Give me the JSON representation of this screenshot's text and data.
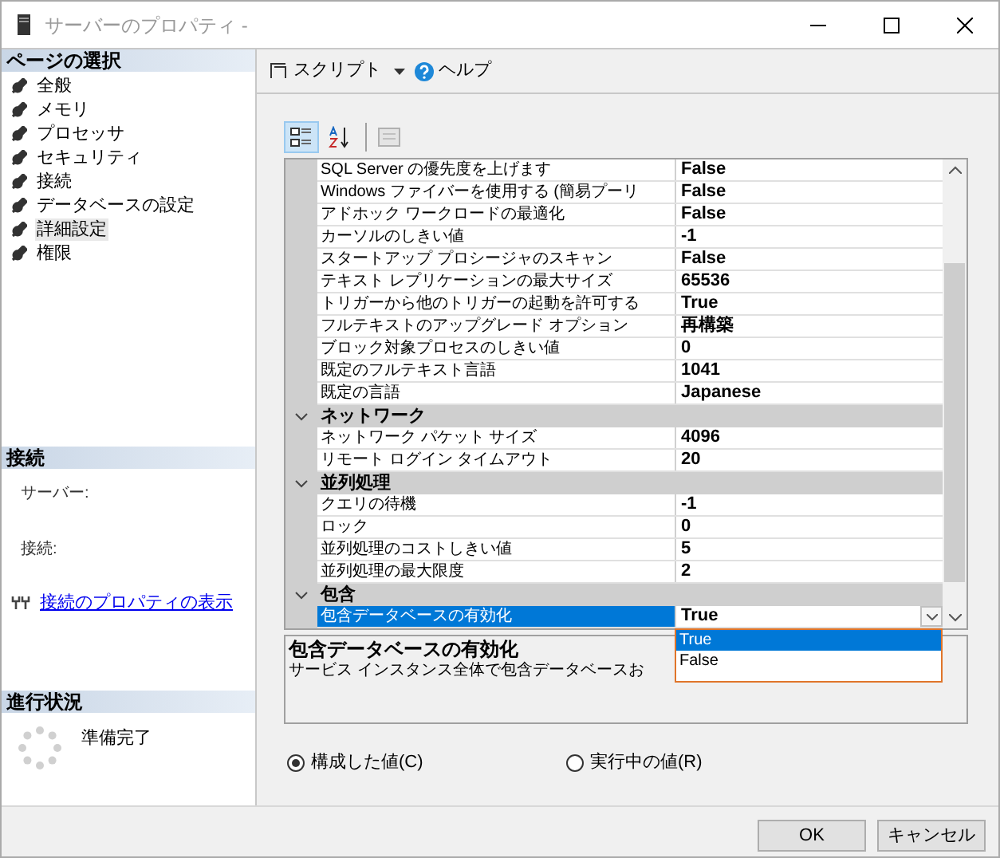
{
  "window": {
    "title": "サーバーのプロパティ -"
  },
  "sidebar": {
    "header": "ページの選択",
    "items": [
      {
        "label": "全般",
        "selected": false
      },
      {
        "label": "メモリ",
        "selected": false
      },
      {
        "label": "プロセッサ",
        "selected": false
      },
      {
        "label": "セキュリティ",
        "selected": false
      },
      {
        "label": "接続",
        "selected": false
      },
      {
        "label": "データベースの設定",
        "selected": false
      },
      {
        "label": "詳細設定",
        "selected": true
      },
      {
        "label": "権限",
        "selected": false
      }
    ]
  },
  "connection": {
    "header": "接続",
    "server_label": "サーバー:",
    "connection_label": "接続:",
    "link": "接続のプロパティの表示"
  },
  "progress": {
    "header": "進行状況",
    "status": "準備完了"
  },
  "toolbar": {
    "script": "スクリプト",
    "help": "ヘルプ"
  },
  "grid": {
    "sort_buttons": [
      {
        "kind": "categorized",
        "selected": true
      },
      {
        "kind": "alphabetical",
        "selected": false
      }
    ],
    "groups": [
      {
        "rows": [
          {
            "name": "SQL Server の優先度を上げます",
            "value": "False",
            "selected": false
          },
          {
            "name": "Windows ファイバーを使用する (簡易プーリ",
            "value": "False",
            "selected": false
          },
          {
            "name": "アドホック ワークロードの最適化",
            "value": "False",
            "selected": false
          },
          {
            "name": "カーソルのしきい値",
            "value": "-1",
            "selected": false
          },
          {
            "name": "スタートアップ プロシージャのスキャン",
            "value": "False",
            "selected": false
          },
          {
            "name": "テキスト レプリケーションの最大サイズ",
            "value": "65536",
            "selected": false
          },
          {
            "name": "トリガーから他のトリガーの起動を許可する",
            "value": "True",
            "selected": false
          },
          {
            "name": "フルテキストのアップグレード オプション",
            "value": "再構築",
            "selected": false
          },
          {
            "name": "ブロック対象プロセスのしきい値",
            "value": "0",
            "selected": false
          },
          {
            "name": "既定のフルテキスト言語",
            "value": "1041",
            "selected": false
          },
          {
            "name": "既定の言語",
            "value": "Japanese",
            "selected": false
          }
        ]
      },
      {
        "name": "ネットワーク",
        "expanded": true,
        "rows": [
          {
            "name": "ネットワーク パケット サイズ",
            "value": "4096",
            "selected": false
          },
          {
            "name": "リモート ログイン タイムアウト",
            "value": "20",
            "selected": false
          }
        ]
      },
      {
        "name": "並列処理",
        "expanded": true,
        "rows": [
          {
            "name": "クエリの待機",
            "value": "-1",
            "selected": false
          },
          {
            "name": "ロック",
            "value": "0",
            "selected": false
          },
          {
            "name": "並列処理のコストしきい値",
            "value": "5",
            "selected": false
          },
          {
            "name": "並列処理の最大限度",
            "value": "2",
            "selected": false
          }
        ]
      },
      {
        "name": "包含",
        "expanded": true,
        "rows": [
          {
            "name": "包含データベースの有効化",
            "value": "True",
            "selected": true
          }
        ]
      }
    ],
    "dropdown": {
      "options": [
        {
          "label": "True",
          "selected": true
        },
        {
          "label": "False",
          "selected": false
        }
      ]
    }
  },
  "description": {
    "title": "包含データベースの有効化",
    "text": "サービス インスタンス全体で包含データベースお"
  },
  "radios": [
    {
      "label": "構成した値(C)",
      "selected": true
    },
    {
      "label": "実行中の値(R)",
      "selected": false
    }
  ],
  "buttons": [
    "OK",
    "キャンセル"
  ]
}
